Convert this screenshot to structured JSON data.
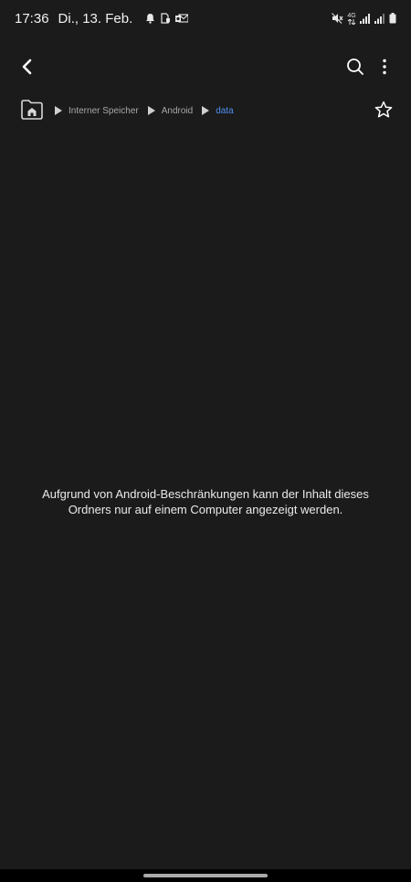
{
  "status_bar": {
    "time": "17:36",
    "date": "Di., 13. Feb.",
    "network_label": "4G",
    "notification_icons": [
      "bell-icon",
      "file-shield-icon",
      "outlook-mail-icon"
    ],
    "system_icons": [
      "mute-icon",
      "signal-icon",
      "signal-icon",
      "battery-icon"
    ]
  },
  "app_bar": {
    "back_icon": "chevron-left-icon",
    "search_icon": "search-icon",
    "more_icon": "more-vertical-icon"
  },
  "breadcrumb": {
    "home_icon": "home-folder-icon",
    "items": [
      {
        "label": "Interner Speicher"
      },
      {
        "label": "Android"
      },
      {
        "label": "data"
      }
    ],
    "active_color": "#4f8ff0"
  },
  "favorite_icon": "star-outline-icon",
  "message": {
    "line1": "Aufgrund von Android-Beschränkungen kann der Inhalt dieses",
    "line2": "Ordners nur auf einem Computer angezeigt werden."
  },
  "colors": {
    "background": "#1b1b1b",
    "text": "#eaeaea",
    "muted": "#a8a8a8",
    "accent": "#4f8ff0"
  }
}
